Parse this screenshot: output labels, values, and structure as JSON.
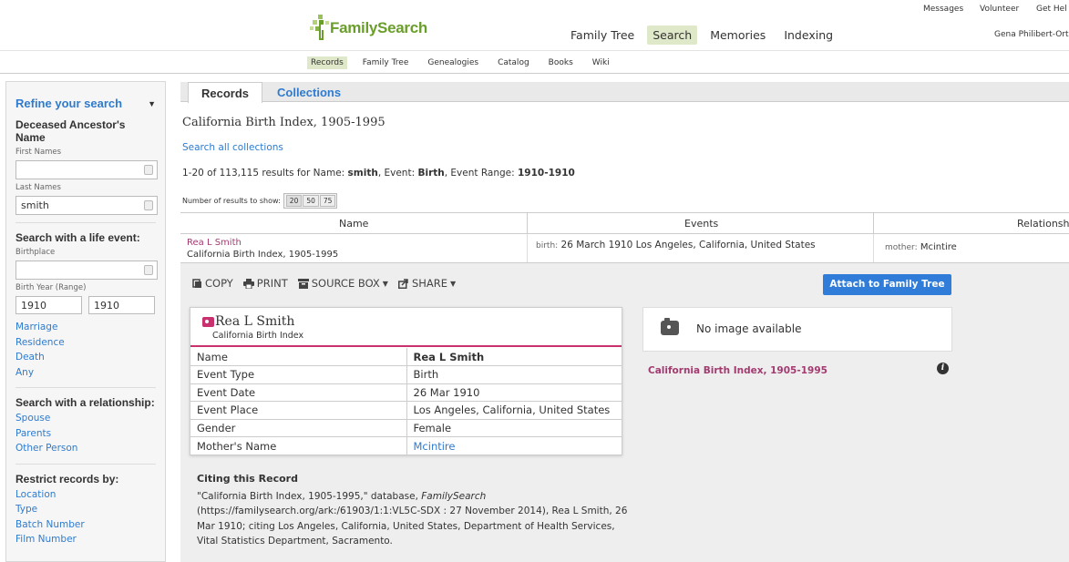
{
  "utility": {
    "messages": "Messages",
    "volunteer": "Volunteer",
    "get_help": "Get Hel",
    "user_name": "Gena Philibert-Ort"
  },
  "logo": {
    "text": "FamilySearch",
    "brand_color": "#6a9e2b"
  },
  "main_nav": [
    {
      "label": "Family Tree",
      "active": false
    },
    {
      "label": "Search",
      "active": true
    },
    {
      "label": "Memories",
      "active": false
    },
    {
      "label": "Indexing",
      "active": false
    }
  ],
  "sub_nav": [
    {
      "label": "Records",
      "active": true
    },
    {
      "label": "Family Tree",
      "active": false
    },
    {
      "label": "Genealogies",
      "active": false
    },
    {
      "label": "Catalog",
      "active": false
    },
    {
      "label": "Books",
      "active": false
    },
    {
      "label": "Wiki",
      "active": false
    }
  ],
  "sidebar": {
    "refine_title": "Refine your search",
    "ancestor_title": "Deceased Ancestor's Name",
    "first_names_label": "First Names",
    "first_names_value": "",
    "last_names_label": "Last Names",
    "last_names_value": "smith",
    "life_event_title": "Search with a life event:",
    "birthplace_label": "Birthplace",
    "birthplace_value": "",
    "birth_year_label": "Birth Year (Range)",
    "birth_year_from": "1910",
    "birth_year_to": "1910",
    "event_links": [
      "Marriage",
      "Residence",
      "Death",
      "Any"
    ],
    "relationship_title": "Search with a relationship:",
    "relationship_links": [
      "Spouse",
      "Parents",
      "Other Person"
    ],
    "restrict_title": "Restrict records by:",
    "restrict_links": [
      "Location",
      "Type",
      "Batch Number",
      "Film Number"
    ]
  },
  "tabs": {
    "records": "Records",
    "collections": "Collections"
  },
  "collection_title": "California Birth Index, 1905-1995",
  "search_all": "Search all collections",
  "results": {
    "prefix": "1-20 of 113,115 results for Name: ",
    "name": "smith",
    "mid1": ", Event: ",
    "event": "Birth",
    "mid2": ", Event Range: ",
    "range": "1910-1910"
  },
  "num_show": {
    "label": "Number of results to show:",
    "options": [
      "20",
      "50",
      "75"
    ]
  },
  "grid": {
    "headers": {
      "name": "Name",
      "events": "Events",
      "relationships": "Relationsh"
    },
    "row": {
      "name": "Rea L Smith",
      "collection": "California Birth Index, 1905-1995",
      "event_key": "birth:",
      "event_value": "26 March 1910  Los Angeles, California, United States",
      "rel_key": "mother:",
      "rel_value": "Mcintire"
    }
  },
  "actions": {
    "copy": "COPY",
    "print": "PRINT",
    "source_box": "SOURCE BOX",
    "share": "SHARE",
    "attach": "Attach to Family Tree"
  },
  "record_card": {
    "name": "Rea L Smith",
    "subtitle": "California Birth Index",
    "accent_color": "#c8306e",
    "rows": [
      {
        "key": "Name",
        "value": "Rea L Smith"
      },
      {
        "key": "Event Type",
        "value": "Birth"
      },
      {
        "key": "Event Date",
        "value": "26 Mar 1910"
      },
      {
        "key": "Event Place",
        "value": "Los Angeles, California, United States"
      },
      {
        "key": "Gender",
        "value": "Female"
      },
      {
        "key": "Mother's Name",
        "value": "Mcintire"
      }
    ]
  },
  "image_panel": {
    "no_image": "No image available",
    "collection_link": "California Birth Index, 1905-1995"
  },
  "citation": {
    "title": "Citing this Record",
    "text_1": "\"California Birth Index, 1905-1995,\" database, ",
    "source_italic": "FamilySearch",
    "text_2": " (https://familysearch.org/ark:/61903/1:1:VL5C-SDX : 27 November 2014), Rea L Smith, 26 Mar 1910; citing Los Angeles, California, United States, Department of Health Services, Vital Statistics Department, Sacramento."
  }
}
